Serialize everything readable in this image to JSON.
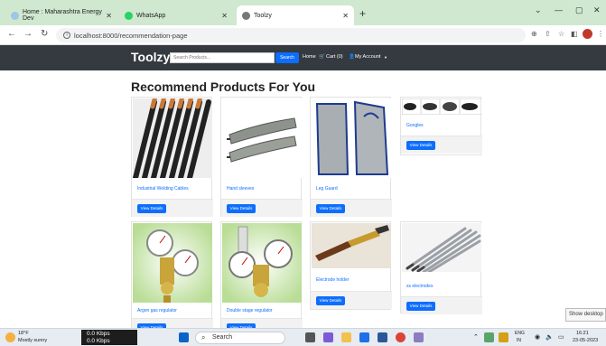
{
  "browser": {
    "tabs": [
      {
        "label": "Home : Maharashtra Energy Dev"
      },
      {
        "label": "WhatsApp"
      },
      {
        "label": "Toolzy"
      }
    ],
    "url": "localhost:8000/recommendation-page"
  },
  "navbar": {
    "brand": "Toolzy",
    "search_placeholder": "Search Products...",
    "search_button": "Search",
    "home": "Home",
    "cart": "Cart (0)",
    "account": "My Account"
  },
  "page": {
    "heading": "Recommend Products For You",
    "view_label": "View Details",
    "products": [
      {
        "title": "Industrial Welding Cables"
      },
      {
        "title": "Hand sleeves"
      },
      {
        "title": "Leg Guard"
      },
      {
        "title": "Googles"
      },
      {
        "title": "Argon gas regulator"
      },
      {
        "title": "Double stage regulator"
      },
      {
        "title": "Electrode holder"
      },
      {
        "title": "ss electrodes"
      }
    ]
  },
  "taskbar": {
    "weather_temp": "18°F",
    "weather_desc": "Mostly sunny",
    "net_up": "0.0 Kbps",
    "net_down": "0.0 Kbps",
    "search": "Search",
    "lang1": "ENG",
    "lang2": "IN",
    "time": "16:21",
    "date": "23-05-2023"
  },
  "tooltip": "Show desktop"
}
